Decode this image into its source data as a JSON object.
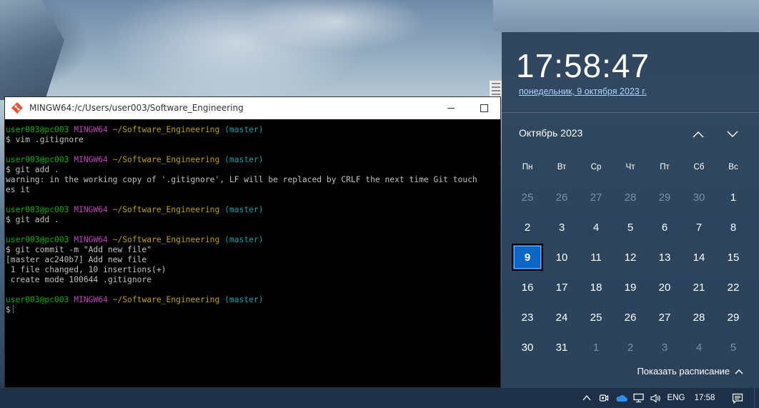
{
  "terminal": {
    "title": "MINGW64:/c/Users/user003/Software_Engineering",
    "prompt": {
      "user": "user003@pc003",
      "shell": "MINGW64",
      "path": "~/Software_Engineering",
      "branch": "(master)"
    },
    "lines": [
      {
        "kind": "prompt"
      },
      {
        "kind": "text",
        "text": "$ vim .gitignore"
      },
      {
        "kind": "blank"
      },
      {
        "kind": "prompt"
      },
      {
        "kind": "text",
        "text": "$ git add ."
      },
      {
        "kind": "text",
        "text": "warning: in the working copy of '.gitignore', LF will be replaced by CRLF the next time Git touch"
      },
      {
        "kind": "text",
        "text": "es it"
      },
      {
        "kind": "blank"
      },
      {
        "kind": "prompt"
      },
      {
        "kind": "text",
        "text": "$ git add ."
      },
      {
        "kind": "blank"
      },
      {
        "kind": "prompt"
      },
      {
        "kind": "text",
        "text": "$ git commit -m \"Add new file\""
      },
      {
        "kind": "text",
        "text": "[master ac240b7] Add new file"
      },
      {
        "kind": "text",
        "text": " 1 file changed, 10 insertions(+)"
      },
      {
        "kind": "text",
        "text": " create mode 100644 .gitignore"
      },
      {
        "kind": "blank"
      },
      {
        "kind": "prompt"
      },
      {
        "kind": "cursor",
        "text": "$"
      }
    ],
    "colors": {
      "user": "#00b300",
      "shell": "#bf3fbf",
      "path": "#c0a000",
      "branch": "#00a6b2",
      "text": "#c0c0c0"
    }
  },
  "flyout": {
    "time": "17:58:47",
    "date": "понедельник, 9 октября 2023 г.",
    "month": "Октябрь 2023",
    "weekdays": [
      "Пн",
      "Вт",
      "Ср",
      "Чт",
      "Пт",
      "Сб",
      "Вс"
    ],
    "days": [
      {
        "d": "25",
        "dim": true
      },
      {
        "d": "26",
        "dim": true
      },
      {
        "d": "27",
        "dim": true
      },
      {
        "d": "28",
        "dim": true
      },
      {
        "d": "29",
        "dim": true
      },
      {
        "d": "30",
        "dim": true
      },
      {
        "d": "1"
      },
      {
        "d": "2"
      },
      {
        "d": "3"
      },
      {
        "d": "4"
      },
      {
        "d": "5"
      },
      {
        "d": "6"
      },
      {
        "d": "7"
      },
      {
        "d": "8"
      },
      {
        "d": "9",
        "today": true
      },
      {
        "d": "10"
      },
      {
        "d": "11"
      },
      {
        "d": "12"
      },
      {
        "d": "13"
      },
      {
        "d": "14"
      },
      {
        "d": "15"
      },
      {
        "d": "16"
      },
      {
        "d": "17"
      },
      {
        "d": "18"
      },
      {
        "d": "19"
      },
      {
        "d": "20"
      },
      {
        "d": "21"
      },
      {
        "d": "22"
      },
      {
        "d": "23"
      },
      {
        "d": "24"
      },
      {
        "d": "25"
      },
      {
        "d": "26"
      },
      {
        "d": "27"
      },
      {
        "d": "28"
      },
      {
        "d": "29"
      },
      {
        "d": "30"
      },
      {
        "d": "31"
      },
      {
        "d": "1",
        "dim": true
      },
      {
        "d": "2",
        "dim": true
      },
      {
        "d": "3",
        "dim": true
      },
      {
        "d": "4",
        "dim": true
      },
      {
        "d": "5",
        "dim": true
      }
    ],
    "schedule_label": "Показать расписание",
    "accent": "#0b67c6",
    "background": "#2c435c"
  },
  "taskbar": {
    "language": "ENG",
    "clock": "17:58",
    "icons": [
      "chevron-up-icon",
      "meet-now-icon",
      "onedrive-cloud-icon",
      "network-icon",
      "volume-icon"
    ]
  }
}
